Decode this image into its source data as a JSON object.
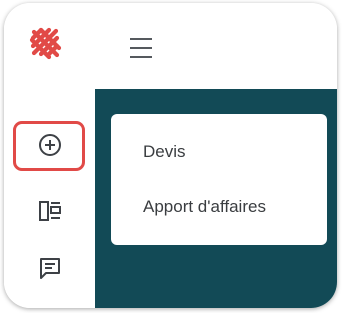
{
  "colors": {
    "brand_red": "#e14a47",
    "sidebar_teal": "#124a56",
    "icon_gray": "#3d4146",
    "highlight_red": "#e14a47"
  },
  "header": {
    "logo_icon": "brand-logo-icon",
    "menu_icon": "hamburger-menu-icon"
  },
  "rail": {
    "items": [
      {
        "icon": "add-circle-icon"
      },
      {
        "icon": "kanban-board-icon"
      },
      {
        "icon": "chat-icon"
      }
    ]
  },
  "menu": {
    "items": [
      {
        "label": "Devis"
      },
      {
        "label": "Apport d'affaires"
      }
    ]
  }
}
